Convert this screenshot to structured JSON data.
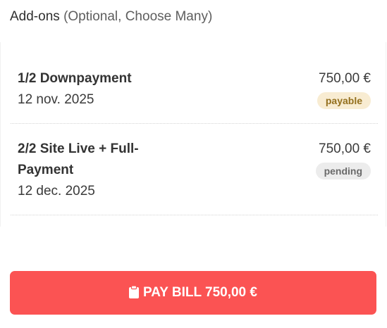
{
  "addons": {
    "title": "Add-ons",
    "subtitle": "(Optional, Choose Many)"
  },
  "installments": [
    {
      "title": "1/2 Downpayment",
      "date": "12 nov. 2025",
      "amount": "750,00 €",
      "status": "payable",
      "status_color": "#94701e",
      "status_bg": "#f8ecd2"
    },
    {
      "title": "2/2 Site Live + Full-Payment",
      "date": "12 dec. 2025",
      "amount": "750,00 €",
      "status": "pending",
      "status_color": "#6a6a6a",
      "status_bg": "#ececec"
    }
  ],
  "pay_button": {
    "label": "PAY BILL 750,00 €",
    "icon": "clipboard-icon",
    "color": "#fb5353"
  }
}
